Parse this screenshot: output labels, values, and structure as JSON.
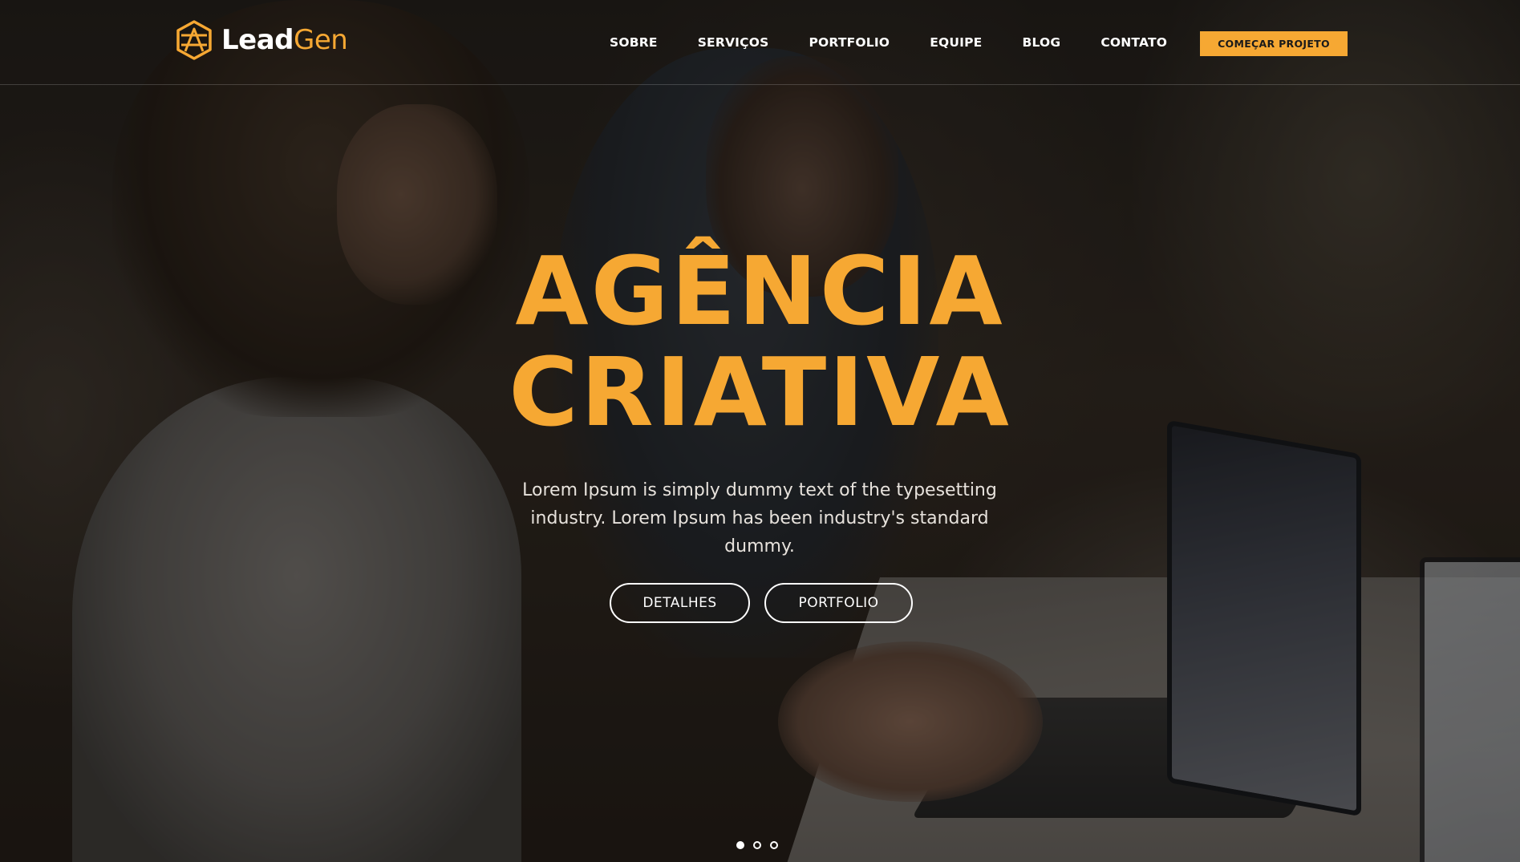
{
  "brand": {
    "name_primary": "Lead",
    "name_accent": "Gen",
    "logo_icon": "hexagon-stripes-icon",
    "accent_color": "#f6a833"
  },
  "nav": {
    "items": [
      {
        "label": "SOBRE"
      },
      {
        "label": "SERVIÇOS"
      },
      {
        "label": "PORTFOLIO"
      },
      {
        "label": "EQUIPE"
      },
      {
        "label": "BLOG"
      },
      {
        "label": "CONTATO"
      }
    ],
    "cta_label": "COMEÇAR PROJETO"
  },
  "hero": {
    "headline_line1": "AGÊNCIA",
    "headline_line2": "CRIATIVA",
    "subtitle": "Lorem Ipsum is simply dummy text of the typesetting industry. Lorem Ipsum has been industry's standard dummy.",
    "buttons": {
      "details_label": "DETALHES",
      "portfolio_label": "PORTFOLIO"
    },
    "background_image": "two people working on laptops in a café",
    "slider": {
      "total": 3,
      "active_index": 0
    }
  }
}
